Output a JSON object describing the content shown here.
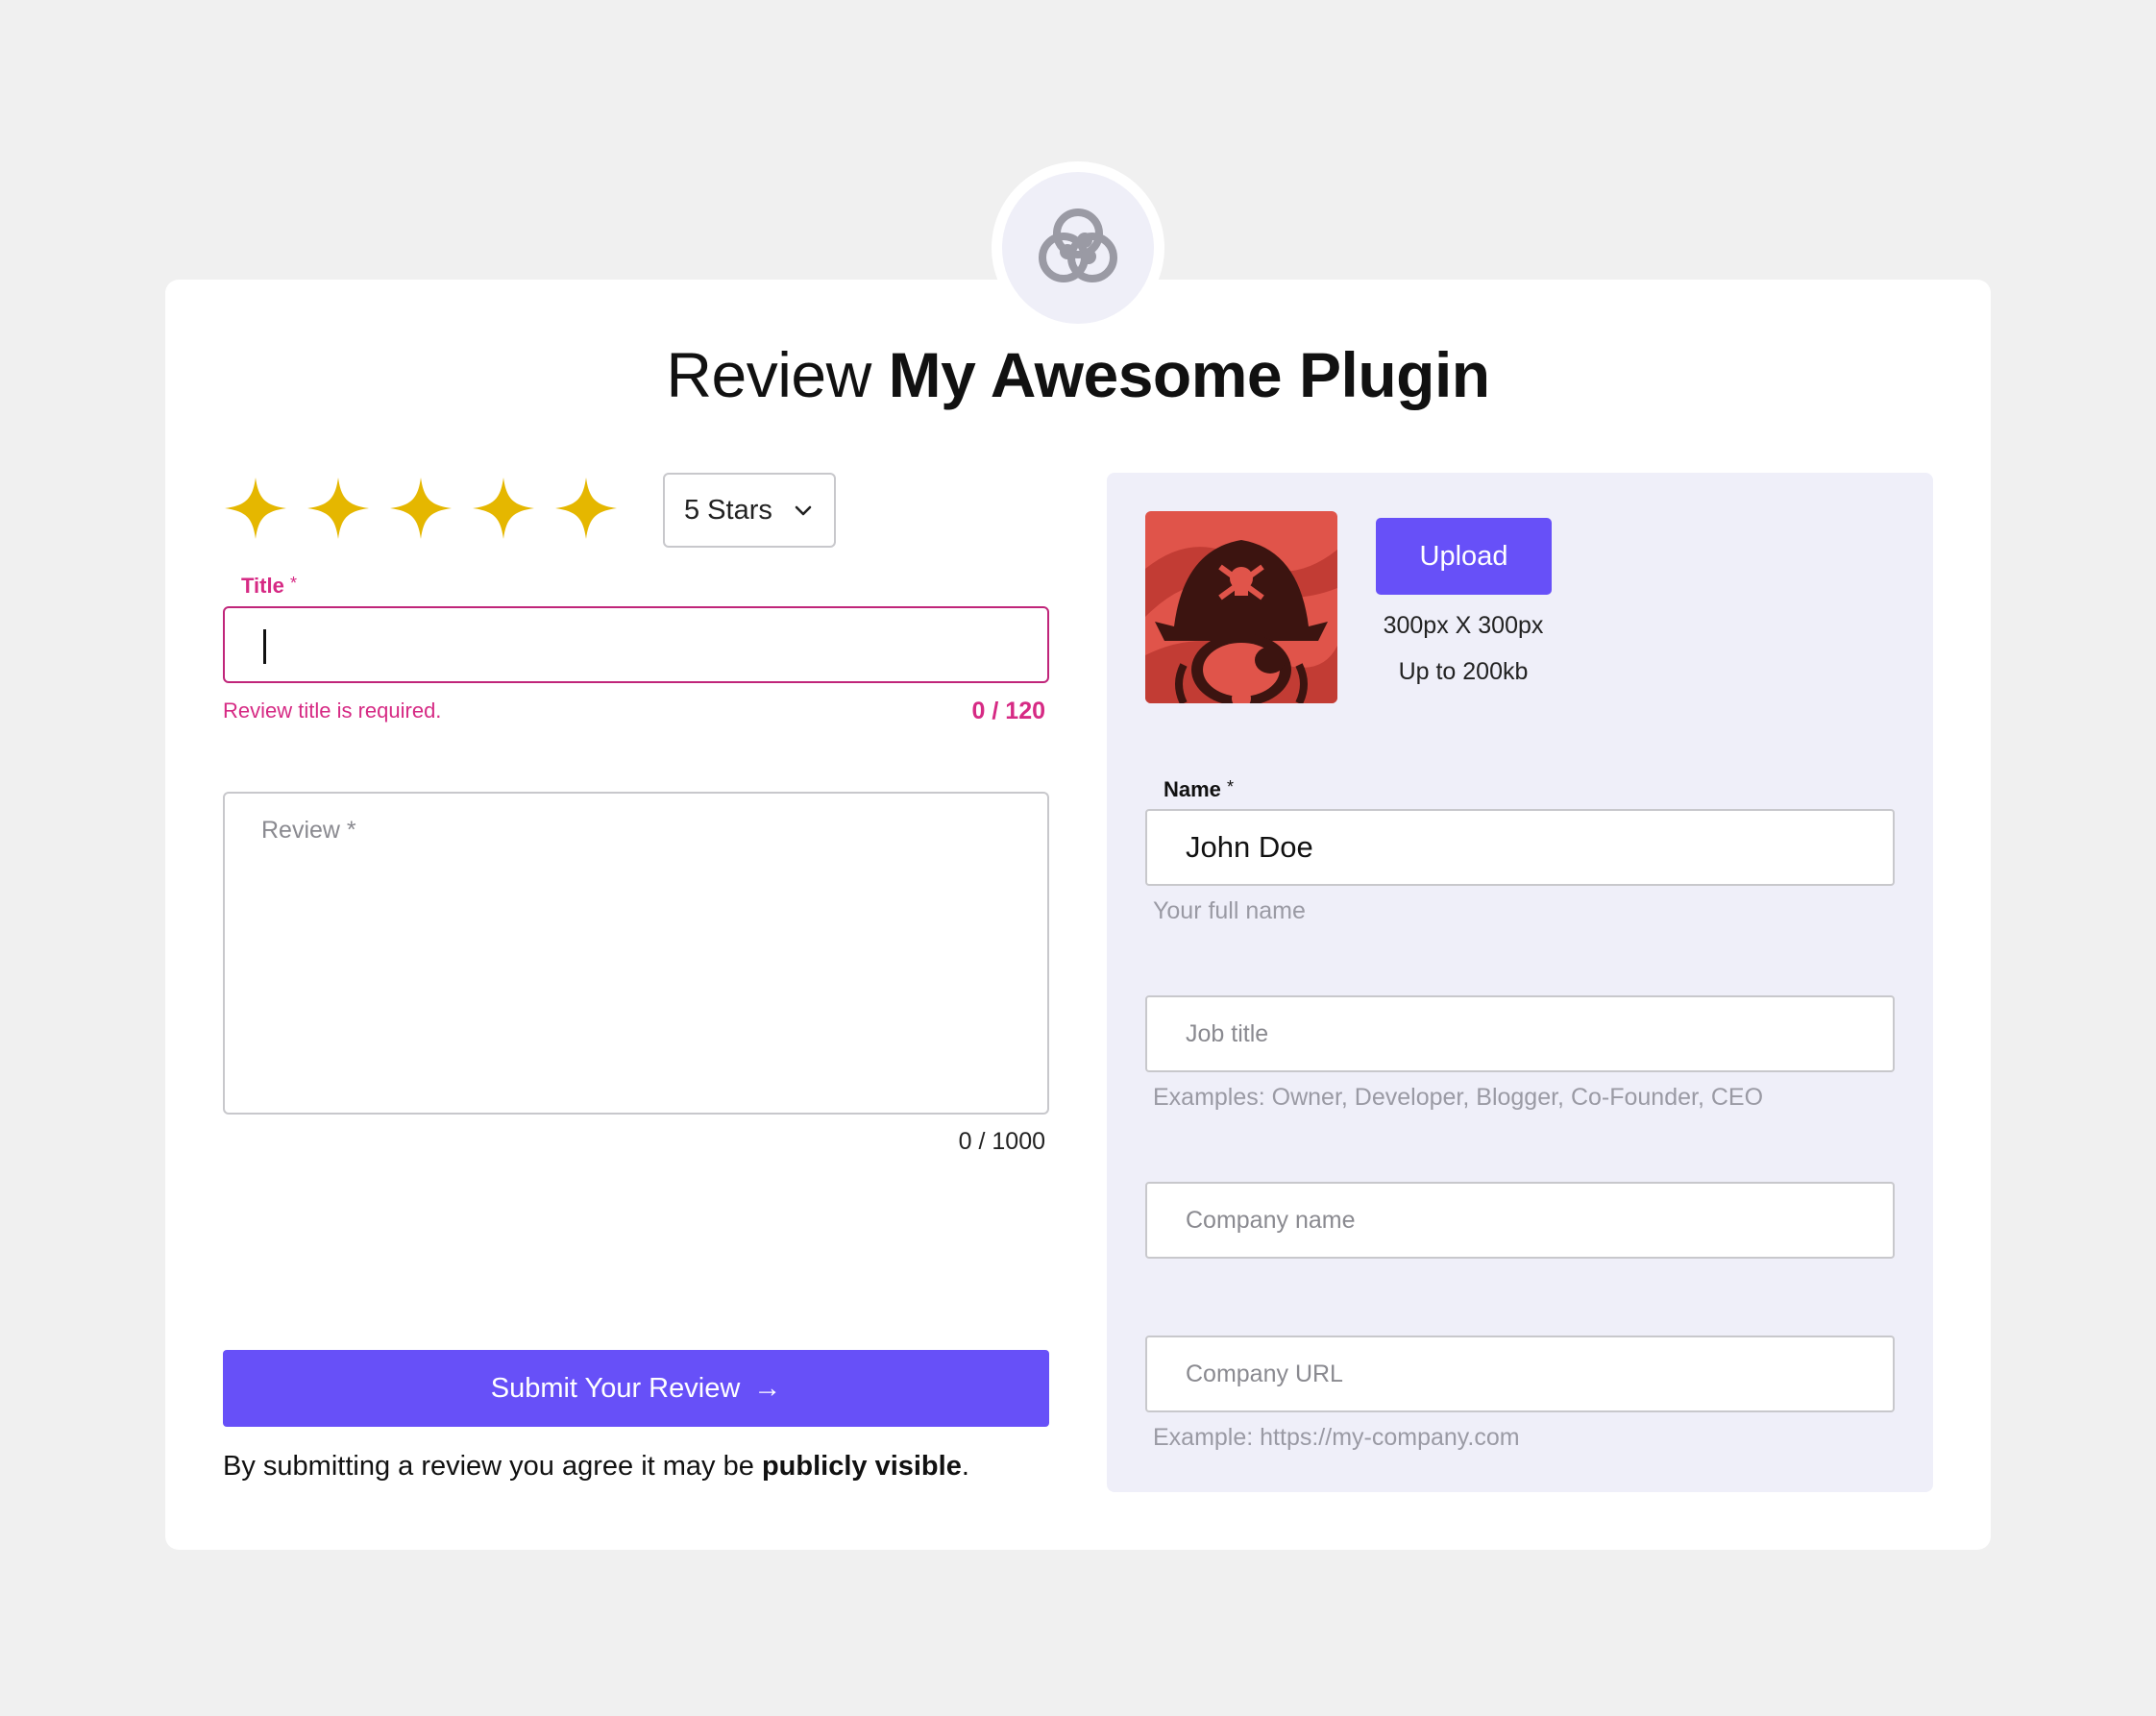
{
  "header": {
    "title_prefix": "Review",
    "title_plugin": "My Awesome Plugin"
  },
  "rating": {
    "stars_filled": 5,
    "stars_total": 5,
    "star_color": "#e5b700",
    "select_value": "5 Stars"
  },
  "title_field": {
    "label": "Title",
    "required_mark": "*",
    "value": "",
    "error": "Review title is required.",
    "counter": "0 / 120"
  },
  "review_field": {
    "placeholder": "Review *",
    "counter": "0 / 1000"
  },
  "submit": {
    "label": "Submit Your Review",
    "arrow": "→"
  },
  "disclaimer": {
    "text": "By submitting a review you agree it may be",
    "bold": "publicly visible",
    "end": "."
  },
  "avatar_upload": {
    "button_label": "Upload",
    "dimensions": "300px X 300px",
    "size_limit": "Up to 200kb"
  },
  "name_field": {
    "label": "Name",
    "required_mark": "*",
    "value": "John Doe",
    "helper": "Your full name"
  },
  "job_field": {
    "placeholder": "Job title",
    "helper": "Examples: Owner, Developer, Blogger, Co-Founder, CEO"
  },
  "company_field": {
    "placeholder": "Company name"
  },
  "url_field": {
    "placeholder": "Company URL",
    "helper": "Example: https://my-company.com"
  },
  "colors": {
    "accent": "#6750f8",
    "error": "#d62a84",
    "panel_bg": "#efeff9"
  }
}
